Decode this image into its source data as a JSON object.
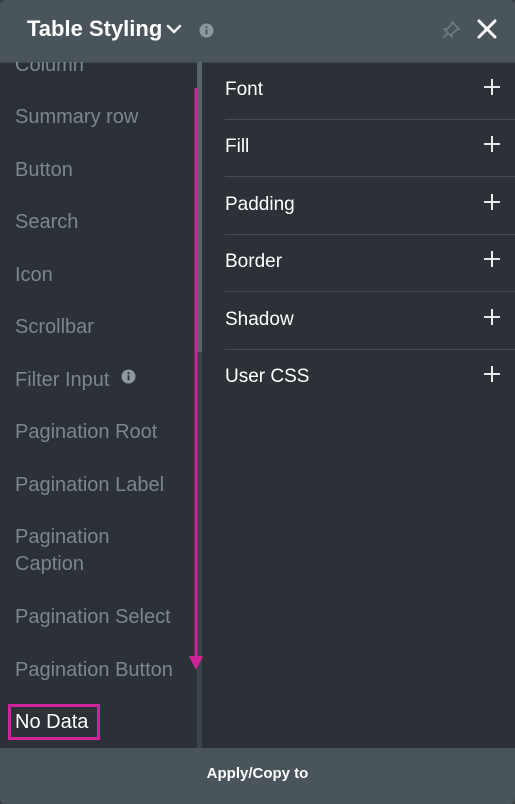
{
  "header": {
    "title": "Table Styling",
    "icons": {
      "expand": "chevron-down-icon",
      "info": "info-icon",
      "pin": "pin-icon",
      "close": "close-icon"
    }
  },
  "sidebar": {
    "items": [
      {
        "label": "Column",
        "active": false
      },
      {
        "label": "Summary row",
        "active": false
      },
      {
        "label": "Button",
        "active": false
      },
      {
        "label": "Search",
        "active": false
      },
      {
        "label": "Icon",
        "active": false
      },
      {
        "label": "Scrollbar",
        "active": false
      },
      {
        "label": "Filter Input",
        "active": false,
        "icon": "info-icon"
      },
      {
        "label": "Pagination Root",
        "active": false
      },
      {
        "label": "Pagination Label",
        "active": false
      },
      {
        "label": "Pagination Caption",
        "active": false
      },
      {
        "label": "Pagination Select",
        "active": false
      },
      {
        "label": "Pagination Button",
        "active": false
      },
      {
        "label": "No Data",
        "active": true
      }
    ]
  },
  "sections": [
    {
      "label": "Font",
      "icon": "plus-icon"
    },
    {
      "label": "Fill",
      "icon": "plus-icon"
    },
    {
      "label": "Padding",
      "icon": "plus-icon"
    },
    {
      "label": "Border",
      "icon": "plus-icon"
    },
    {
      "label": "Shadow",
      "icon": "plus-icon"
    },
    {
      "label": "User CSS",
      "icon": "plus-icon"
    }
  ],
  "footer": {
    "button_label": "Apply/Copy to"
  },
  "colors": {
    "panel_bg": "#2b3136",
    "header_bg": "#4a555b",
    "text_active": "#ffffff",
    "text_muted": "#7c878d",
    "highlight": "#d0229b"
  }
}
